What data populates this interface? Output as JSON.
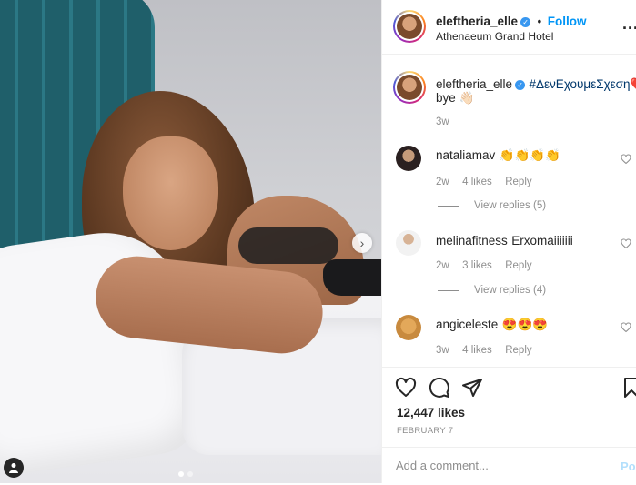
{
  "post": {
    "author": "eleftheria_elle",
    "follow_label": "Follow",
    "separator": "•",
    "location": "Athenaeum Grand Hotel",
    "more_label": "...",
    "caption_hashtag": "#ΔενΕχουμεΣχεση💔",
    "caption_text": "bye 👋🏻",
    "caption_time": "3w",
    "likes": "12,447 likes",
    "date": "FEBRUARY 7",
    "carousel_count": 2,
    "carousel_active": 0
  },
  "comments": [
    {
      "user": "nataliamav",
      "text": "👏👏👏👏",
      "time": "2w",
      "likes": "4 likes",
      "reply": "Reply",
      "view_replies": "View replies (5)"
    },
    {
      "user": "melinafitness",
      "text": "Erxomaiiiiiii",
      "time": "2w",
      "likes": "3 likes",
      "reply": "Reply",
      "view_replies": "View replies (4)"
    },
    {
      "user": "angiceleste",
      "text": "😍😍😍",
      "time": "3w",
      "likes": "4 likes",
      "reply": "Reply"
    }
  ],
  "comment_box": {
    "placeholder": "Add a comment...",
    "post_label": "Post"
  },
  "icons": {
    "verified": "verified-badge-icon",
    "like": "heart-icon",
    "comment": "comment-icon",
    "share": "share-icon",
    "save": "bookmark-icon",
    "next": "chevron-right-icon",
    "tag": "user-tag-icon"
  },
  "colors": {
    "accent": "#0095f6",
    "verified": "#3897f0",
    "hashtag": "#00376b",
    "muted": "#8e8e8e"
  }
}
